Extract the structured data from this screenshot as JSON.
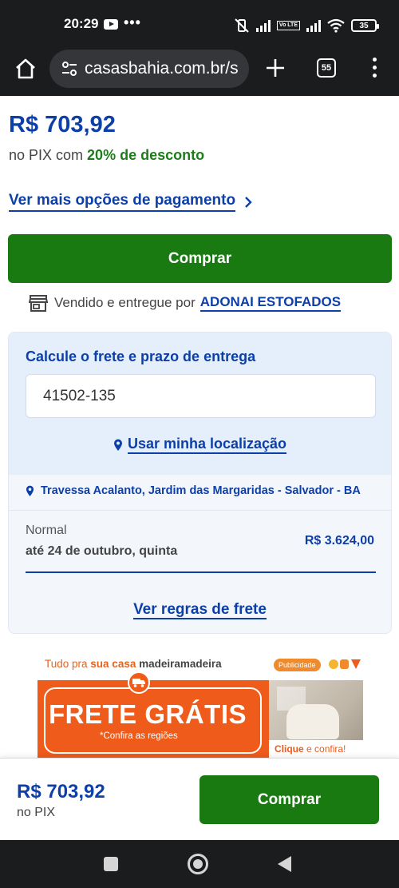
{
  "status_bar": {
    "time": "20:29",
    "dots": "•••",
    "volte": "Vo LTE",
    "battery": "35"
  },
  "browser": {
    "url": "casasbahia.com.br/s",
    "tab_count": "55",
    "icons": [
      "home-icon",
      "site-settings-icon",
      "new-tab-icon",
      "tab-switcher-icon",
      "overflow-menu-icon"
    ]
  },
  "product": {
    "price": "R$ 703,92",
    "pix_prefix": "no PIX com ",
    "pix_discount": "20% de desconto",
    "more_payment_label": "Ver mais opções de pagamento",
    "buy_label": "Comprar",
    "seller_prefix": "Vendido e entregue por",
    "seller_name": "ADONAI ESTOFADOS"
  },
  "freight": {
    "title": "Calcule o frete e prazo de entrega",
    "cep_value": "41502-135",
    "use_location_label": "Usar minha localização",
    "address": "Travessa Acalanto, Jardim das Margaridas - Salvador - BA",
    "option_name": "Normal",
    "option_date": "até 24 de outubro, quinta",
    "option_price": "R$ 3.624,00",
    "rules_label": "Ver regras de frete"
  },
  "ad": {
    "head_prefix": "Tudo pra ",
    "head_bold": "sua casa",
    "head_brand_a": " madeira",
    "head_brand_b": "madeira",
    "badge": "Publicidade",
    "headline": "FRETE GRÁTIS",
    "subtext": "*Confira as regiões",
    "cta_bold": "Clique",
    "cta_rest": " e confira!"
  },
  "sticky": {
    "price": "R$ 703,92",
    "pix_label": "no PIX",
    "buy_label": "Comprar"
  },
  "colors": {
    "brand_blue": "#0d3fa8",
    "buy_green": "#1a7a12",
    "discount_green": "#1c7d1a",
    "ad_orange": "#ef5b1a"
  }
}
